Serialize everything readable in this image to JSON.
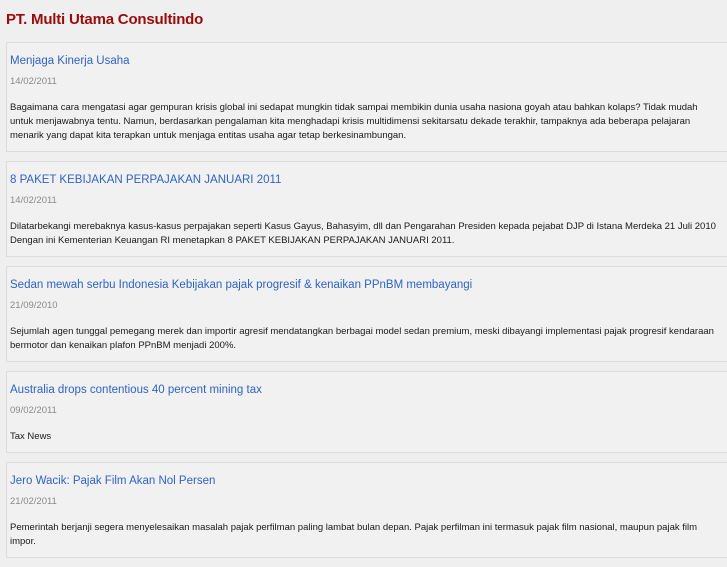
{
  "site": {
    "title": "PT. Multi Utama Consultindo"
  },
  "posts": [
    {
      "title": "Menjaga Kinerja Usaha",
      "date": "14/02/2011",
      "body": "Bagaimana cara mengatasi agar gempuran krisis global ini sedapat mungkin tidak sampai membikin dunia usaha nasiona goyah atau bahkan kolaps? Tidak mudah untuk menjawabnya tentu. Namun, berdasarkan pengalaman kita menghadapi krisis multidimensi sekitarsatu dekade terakhir, tampaknya ada beberapa pelajaran menarik yang dapat kita terapkan untuk menjaga entitas usaha agar tetap berkesinambungan."
    },
    {
      "title": "8 PAKET KEBIJAKAN PERPAJAKAN JANUARI 2011",
      "date": "14/02/2011",
      "body": "Dilatarbekangi merebaknya kasus-kasus perpajakan seperti Kasus Gayus, Bahasyim, dll dan Pengarahan Presiden kepada pejabat DJP di Istana Merdeka 21 Juli 2010 Dengan ini Kementerian Keuangan RI menetapkan 8 PAKET KEBIJAKAN PERPAJAKAN JANUARI 2011."
    },
    {
      "title": "Sedan mewah serbu Indonesia Kebijakan pajak progresif & kenaikan PPnBM membayangi",
      "date": "21/09/2010",
      "body": "Sejumlah agen tunggal pemegang merek dan importir agresif mendatangkan berbagai model sedan premium, meski dibayangi implementasi pajak progresif kendaraan bermotor dan kenaikan plafon PPnBM menjadi 200%."
    },
    {
      "title": "Australia drops contentious 40 percent mining tax",
      "date": "09/02/2011",
      "body": "Tax News"
    },
    {
      "title": "Jero Wacik: Pajak Film Akan Nol Persen",
      "date": "21/02/2011",
      "body": "Pemerintah berjanji segera menyelesaikan masalah pajak perfilman paling lambat bulan depan. Pajak perfilman ini termasuk pajak film nasional, maupun pajak film impor."
    }
  ]
}
